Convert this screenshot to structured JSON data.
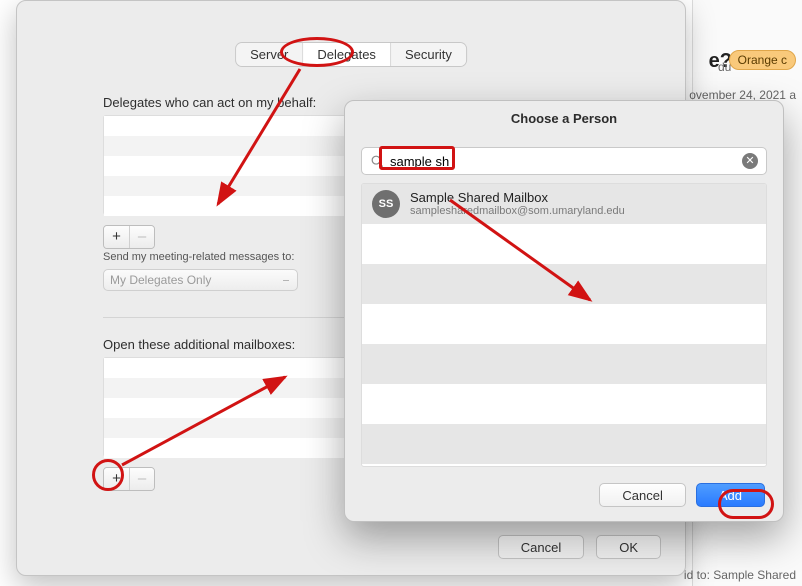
{
  "background": {
    "title_fragment": "e?",
    "badge": "Orange c",
    "date_fragment": "ovember 24, 2021 a",
    "domain_fragment": "du",
    "footer_fragment": "id to: Sample Shared"
  },
  "main_window": {
    "tabs": [
      "Server",
      "Delegates",
      "Security"
    ],
    "active_tab_index": 1,
    "delegates_label": "Delegates who can act on my behalf:",
    "meeting_label": "Send my meeting-related messages to:",
    "meeting_dropdown": "My Delegates Only",
    "additional_label": "Open these additional mailboxes:",
    "plus": "+",
    "minus": "–",
    "cancel_label": "Cancel",
    "ok_label": "OK"
  },
  "sheet": {
    "title": "Choose a Person",
    "search_value": "sample sh",
    "clear_symbol": "✕",
    "result": {
      "initials": "SS",
      "name": "Sample Shared Mailbox",
      "email": "samplesharedmailbox@som.umaryland.edu"
    },
    "cancel_label": "Cancel",
    "add_label": "Add"
  }
}
